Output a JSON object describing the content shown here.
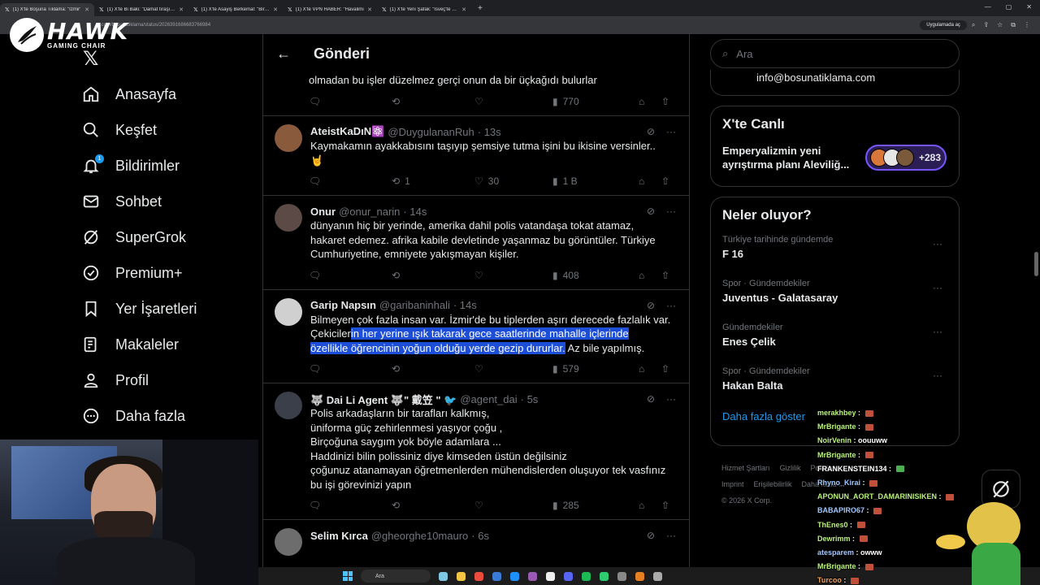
{
  "browser": {
    "tabs": [
      {
        "title": "(1) X'te Boşuna Tıklama: \"İzmir'",
        "active": true
      },
      {
        "title": "(1) X'te Bi Baki: \"Damat tıraşı ve",
        "active": false
      },
      {
        "title": "(1) X'te Asayiş Berkemal: \"Bir m",
        "active": false
      },
      {
        "title": "(1) X'te VPN HABER: \"Havalimı",
        "active": false
      },
      {
        "title": "(1) X'te Yeni Şafak: \"İsveç'te yaş",
        "active": false
      }
    ],
    "url": "x.com/bosunatiklama/status/2026391686683766984",
    "open_app": "Uygulamada aç"
  },
  "overlay": {
    "logo_title": "HAWK",
    "logo_subtitle": "GAMING CHAIR"
  },
  "nav": {
    "items": [
      {
        "label": "Anasayfa",
        "icon": "home-icon"
      },
      {
        "label": "Keşfet",
        "icon": "search-icon"
      },
      {
        "label": "Bildirimler",
        "icon": "bell-icon",
        "badge": "1"
      },
      {
        "label": "Sohbet",
        "icon": "mail-icon"
      },
      {
        "label": "SuperGrok",
        "icon": "grok-icon"
      },
      {
        "label": "Premium+",
        "icon": "verified-icon"
      },
      {
        "label": "Yer İşaretleri",
        "icon": "bookmark-icon"
      },
      {
        "label": "Makaleler",
        "icon": "article-icon"
      },
      {
        "label": "Profil",
        "icon": "person-icon"
      },
      {
        "label": "Daha fazla",
        "icon": "more-circle-icon"
      }
    ]
  },
  "header": {
    "title": "Gönderi"
  },
  "prev_tweet": {
    "text_tail": "olmadan bu işler düzelmez gerçi onun da bir üçkağıdı bulurlar",
    "views": "770"
  },
  "tweets": [
    {
      "name": "AteistKaDıN⚛️",
      "handle": "@DuygulananRuh",
      "time": "· 13s",
      "text": "Kaymakamın ayakkabısını taşıyıp şemsiye tutma işini bu ikisine versinler..",
      "extra": "🤘",
      "replies": "",
      "retweets": "1",
      "likes": "30",
      "views": "1 B",
      "avatar_color": "#8a5a3c"
    },
    {
      "name": "Onur",
      "handle": "@onur_narin",
      "time": "· 14s",
      "text": "dünyanın hiç bir yerinde, amerika dahil polis vatandaşa tokat atamaz,\nhakaret edemez. afrika kabile devletinde yaşanmaz bu görüntüler. Türkiye\nCumhuriyetine, emniyete yakışmayan kişiler.",
      "replies": "",
      "retweets": "",
      "likes": "",
      "views": "408",
      "avatar_color": "#5b4a45"
    },
    {
      "name": "Garip Napsın",
      "handle": "@garibaninhali",
      "time": "· 14s",
      "text_pre": "Bilmeyen çok fazla insan var. İzmir'de bu tiplerden aşırı derecede fazlalık var.\nÇekiciler",
      "text_hl": "in her yerine ışık takarak gece saatlerinde mahalle içlerinde\nözellikle öğrencinin yoğun olduğu yerde gezip dururlar.",
      "text_post": " Az bile yapılmış.",
      "replies": "",
      "retweets": "",
      "likes": "",
      "views": "579",
      "avatar_color": "#d0d0d0"
    },
    {
      "name": "🐺 Dai Li Agent 🐺\" 戴笠 \" 🐦",
      "handle": "@agent_dai",
      "time": "· 5s",
      "text": "Polis arkadaşların bir tarafları kalkmış,\n üniforma güç zehirlenmesi yaşıyor çoğu ,\nBirçoğuna saygım yok böyle adamlara ...\nHaddinizi bilin polissiniz diye kimseden üstün değilsiniz\nçoğunuz atanamayan öğretmenlerden mühendislerden oluşuyor tek vasfınız\nbu işi görevinizi yapın",
      "replies": "",
      "retweets": "",
      "likes": "",
      "views": "285",
      "avatar_color": "#3a3f4a"
    },
    {
      "name": "Selim Kırca",
      "handle": "@gheorghe10mauro",
      "time": "· 6s",
      "text": "",
      "replies": "",
      "retweets": "",
      "likes": "",
      "views": "",
      "avatar_color": "#6d6d6d"
    }
  ],
  "right": {
    "search_placeholder": "Ara",
    "email": "info@bosunatiklama.com",
    "live_title": "X'te Canlı",
    "live_text": "Emperyalizmin yeni ayrıştırma planı Aleviliğ...",
    "live_count": "+283",
    "trends_title": "Neler oluyor?",
    "trends": [
      {
        "meta": "Türkiye tarihinde gündemde",
        "name": "F 16"
      },
      {
        "meta": "Spor · Gündemdekiler",
        "name": "Juventus - Galatasaray"
      },
      {
        "meta": "Gündemdekiler",
        "name": "Enes Çelik"
      },
      {
        "meta": "Spor · Gündemdekiler",
        "name": "Hakan Balta"
      }
    ],
    "show_more": "Daha fazla göster",
    "footer": [
      "Hizmet Şartları",
      "Gizlilik",
      "Politikası",
      "Imprint",
      "Erişilebilirlik",
      "Daha fazla ...",
      "© 2026 X Corp."
    ]
  },
  "chat": [
    {
      "name": "merakhbey",
      "msg": "",
      "blue": false
    },
    {
      "name": "MrBrigante",
      "msg": "",
      "blue": false
    },
    {
      "name": "NoirVenin",
      "msg": "oouuww",
      "blue": false
    },
    {
      "name": "MrBrigante",
      "msg": "",
      "blue": false
    },
    {
      "name": "FRANKENSTEIN134",
      "msg": "",
      "blue": false
    },
    {
      "name": "Rhyno_Kirai",
      "msg": "",
      "blue": true
    },
    {
      "name": "APONUN_AORT_DAMARINISIKEN",
      "msg": "",
      "blue": false
    },
    {
      "name": "BABAPIRO67",
      "msg": "",
      "blue": true
    },
    {
      "name": "ThEnes0",
      "msg": "",
      "blue": false
    },
    {
      "name": "Dewrimm",
      "msg": "",
      "blue": false
    },
    {
      "name": "atesparem",
      "msg": "owww",
      "blue": true
    },
    {
      "name": "MrBrigante",
      "msg": "",
      "blue": false
    },
    {
      "name": "Turcoo",
      "msg": "",
      "blue": false
    }
  ],
  "taskbar": {
    "search": "Ara"
  },
  "colors": {
    "accent": "#1d9bf0",
    "live_border": "#7856ff",
    "highlight": "#1d4ed8"
  }
}
